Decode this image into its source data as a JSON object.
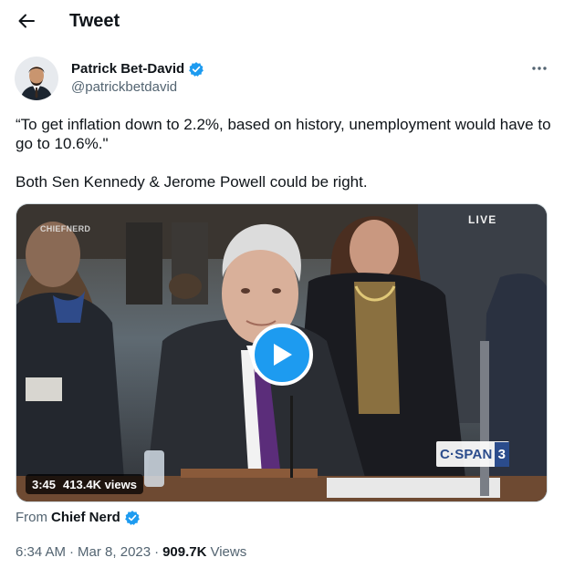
{
  "header": {
    "title": "Tweet"
  },
  "author": {
    "name": "Patrick Bet-David",
    "handle": "@patrickbetdavid"
  },
  "tweet": {
    "paragraphs": [
      "“To get inflation down to 2.2%, based on history, unemployment would have to go to 10.6%.\"",
      "Both Sen Kennedy & Jerome Powell could be right."
    ]
  },
  "media": {
    "watermark": "CHIEFNERD",
    "live_label": "LIVE",
    "network_logo_text": "C·SPAN",
    "network_logo_number": "3",
    "duration": "3:45",
    "views": "413.4K views"
  },
  "source": {
    "from_label": "From",
    "name": "Chief Nerd"
  },
  "meta": {
    "time": "6:34 AM",
    "date": "Mar 8, 2023",
    "views_count": "909.7K",
    "views_label": "Views"
  },
  "colors": {
    "accent": "#1d9bf0",
    "text_primary": "#0f1419",
    "text_secondary": "#536471"
  },
  "icons": {
    "back": "arrow-left-icon",
    "verified": "verified-badge-icon",
    "more": "more-horizontal-icon",
    "play": "play-icon"
  }
}
